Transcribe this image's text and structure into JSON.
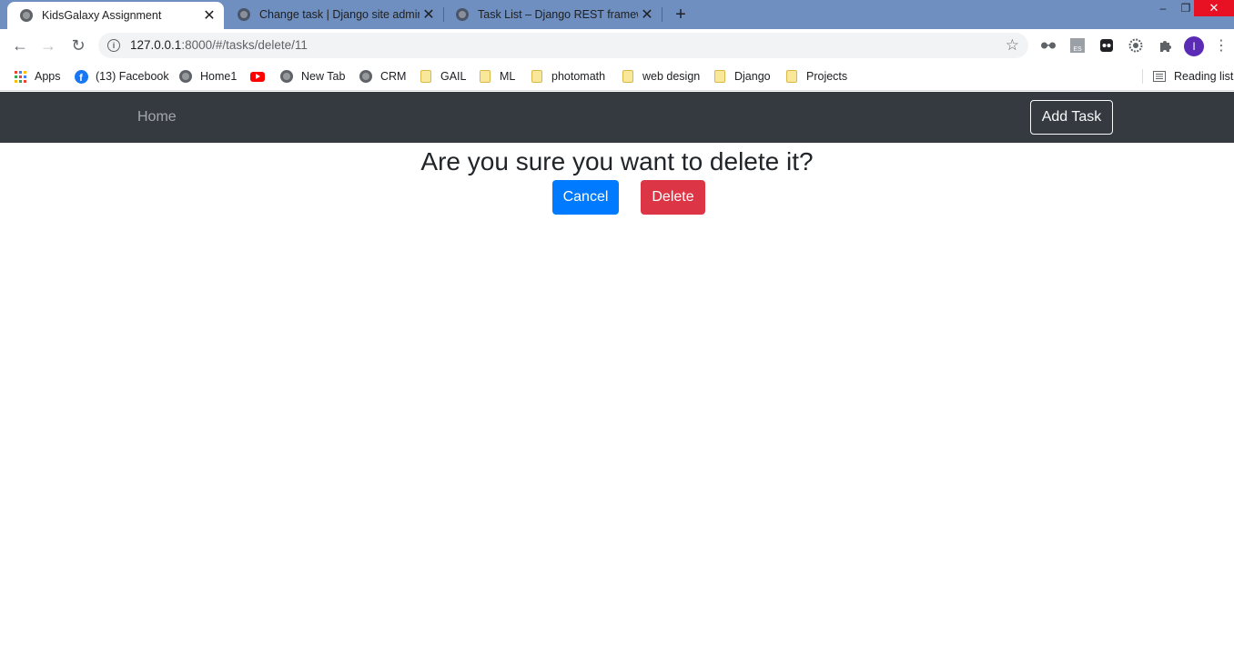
{
  "browser": {
    "tabs": [
      {
        "title": "KidsGalaxy Assignment",
        "active": true
      },
      {
        "title": "Change task | Django site admin",
        "active": false
      },
      {
        "title": "Task List – Django REST framewo",
        "active": false
      }
    ],
    "address": {
      "host": "127.0.0.1",
      "rest": ":8000/#/tasks/delete/11"
    },
    "bookmarks": [
      {
        "label": "Apps",
        "icon": "apps-grid-icon"
      },
      {
        "label": "(13) Facebook",
        "icon": "facebook-icon"
      },
      {
        "label": "Home1",
        "icon": "globe-icon"
      },
      {
        "label": "",
        "icon": "youtube-icon"
      },
      {
        "label": "New Tab",
        "icon": "globe-icon"
      },
      {
        "label": "CRM",
        "icon": "globe-icon"
      },
      {
        "label": "GAIL",
        "icon": "folder-icon"
      },
      {
        "label": "ML",
        "icon": "folder-icon"
      },
      {
        "label": "photomath",
        "icon": "folder-icon"
      },
      {
        "label": "web design",
        "icon": "folder-icon"
      },
      {
        "label": "Django",
        "icon": "folder-icon"
      },
      {
        "label": "Projects",
        "icon": "folder-icon"
      }
    ],
    "reading_list": "Reading list",
    "profile_initial": "I",
    "ext_es_label": "ES"
  },
  "navbar": {
    "home_label": "Home",
    "add_task_label": "Add Task"
  },
  "confirm": {
    "question": "Are you sure you want to delete it?",
    "cancel_label": "Cancel",
    "delete_label": "Delete"
  },
  "colors": {
    "tabstrip": "#6e8fc0",
    "navbar": "#343a40",
    "cancel": "#007bff",
    "delete": "#dc3545"
  }
}
